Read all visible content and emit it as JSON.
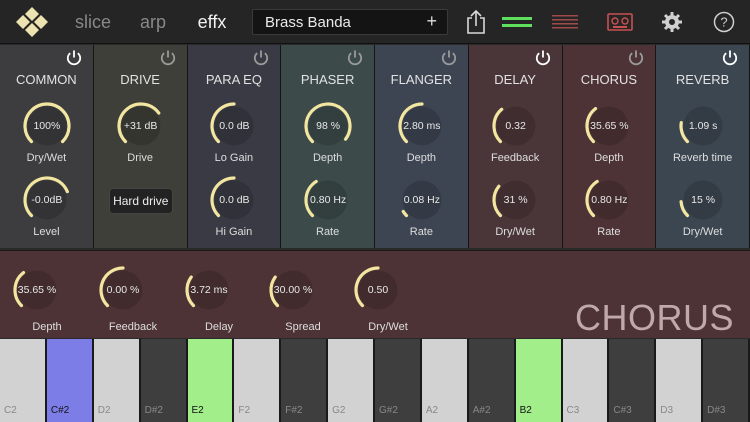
{
  "toolbar": {
    "tabs": [
      "slice",
      "arp",
      "effx"
    ],
    "active_tab": "effx",
    "preset_name": "Brass Banda",
    "preset_add": "+"
  },
  "colors": {
    "accent_green": "#5ee05e",
    "accent_red": "#a04040",
    "knob_arc": "#f3e6a0",
    "active_power": "#ffffff",
    "inactive_power": "#9a9a9a"
  },
  "panels": [
    {
      "title": "COMMON",
      "bg": "#3d3d3f",
      "power_on": true,
      "knobs": [
        {
          "value": "100%",
          "label": "Dry/Wet",
          "level": 1.0
        },
        {
          "value": "-0.0dB",
          "label": "Level",
          "level": 0.75
        }
      ]
    },
    {
      "title": "DRIVE",
      "bg": "#3e3f38",
      "power_on": false,
      "knobs": [
        {
          "value": "+31 dB",
          "label": "Drive",
          "level": 0.7
        }
      ],
      "button": "Hard drive"
    },
    {
      "title": "PARA EQ",
      "bg": "#3a3a44",
      "power_on": false,
      "knobs": [
        {
          "value": "0.0 dB",
          "label": "Lo Gain",
          "level": 0.5
        },
        {
          "value": "0.0 dB",
          "label": "Hi Gain",
          "level": 0.5
        }
      ]
    },
    {
      "title": "PHASER",
      "bg": "#3c4a4a",
      "power_on": false,
      "knobs": [
        {
          "value": "98 %",
          "label": "Depth",
          "level": 0.97
        },
        {
          "value": "0.80 Hz",
          "label": "Rate",
          "level": 0.38
        }
      ]
    },
    {
      "title": "FLANGER",
      "bg": "#3e4552",
      "power_on": false,
      "knobs": [
        {
          "value": "2.80  ms",
          "label": "Depth",
          "level": 0.5
        },
        {
          "value": "0.08  Hz",
          "label": "Rate",
          "level": 0.05
        }
      ]
    },
    {
      "title": "DELAY",
      "bg": "#4a3638",
      "power_on": true,
      "knobs": [
        {
          "value": "0.32",
          "label": "Feedback",
          "level": 0.35
        },
        {
          "value": "31   %",
          "label": "Dry/Wet",
          "level": 0.31
        }
      ]
    },
    {
      "title": "CHORUS",
      "bg": "#4d3336",
      "power_on": false,
      "knobs": [
        {
          "value": "35.65 %",
          "label": "Depth",
          "level": 0.36
        },
        {
          "value": "0.80  Hz",
          "label": "Rate",
          "level": 0.38
        }
      ]
    },
    {
      "title": "REVERB",
      "bg": "#3c4650",
      "power_on": true,
      "knobs": [
        {
          "value": "1.09 s",
          "label": "Reverb time",
          "level": 0.2
        },
        {
          "value": "15 %",
          "label": "Dry/Wet",
          "level": 0.15
        }
      ]
    }
  ],
  "detail": {
    "title": "CHORUS",
    "knobs": [
      {
        "value": "35.65 %",
        "label": "Depth",
        "level": 0.36
      },
      {
        "value": "0.00  %",
        "label": "Feedback",
        "level": 0.5
      },
      {
        "value": "3.72  ms",
        "label": "Delay",
        "level": 0.3
      },
      {
        "value": "30.00 %",
        "label": "Spread",
        "level": 0.3
      },
      {
        "value": "0.50",
        "label": "Dry/Wet",
        "level": 0.5
      }
    ]
  },
  "keyboard": {
    "keys": [
      {
        "note": "C2",
        "color": "white",
        "pressed": ""
      },
      {
        "note": "C#2",
        "color": "black",
        "pressed": "blue"
      },
      {
        "note": "D2",
        "color": "white",
        "pressed": ""
      },
      {
        "note": "D#2",
        "color": "black",
        "pressed": ""
      },
      {
        "note": "E2",
        "color": "white",
        "pressed": "green"
      },
      {
        "note": "F2",
        "color": "white",
        "pressed": ""
      },
      {
        "note": "F#2",
        "color": "black",
        "pressed": ""
      },
      {
        "note": "G2",
        "color": "white",
        "pressed": ""
      },
      {
        "note": "G#2",
        "color": "black",
        "pressed": ""
      },
      {
        "note": "A2",
        "color": "white",
        "pressed": ""
      },
      {
        "note": "A#2",
        "color": "black",
        "pressed": ""
      },
      {
        "note": "B2",
        "color": "white",
        "pressed": "green"
      },
      {
        "note": "C3",
        "color": "white",
        "pressed": ""
      },
      {
        "note": "C#3",
        "color": "black",
        "pressed": ""
      },
      {
        "note": "D3",
        "color": "white",
        "pressed": ""
      },
      {
        "note": "D#3",
        "color": "black",
        "pressed": ""
      }
    ]
  },
  "icons": {
    "logo": "diamond-logo-icon",
    "share": "share-icon",
    "view1": "horizontal-lines-green-icon",
    "view2": "horizontal-lines-red-icon",
    "tape": "tape-recorder-icon",
    "settings": "gear-icon",
    "help": "help-icon"
  }
}
